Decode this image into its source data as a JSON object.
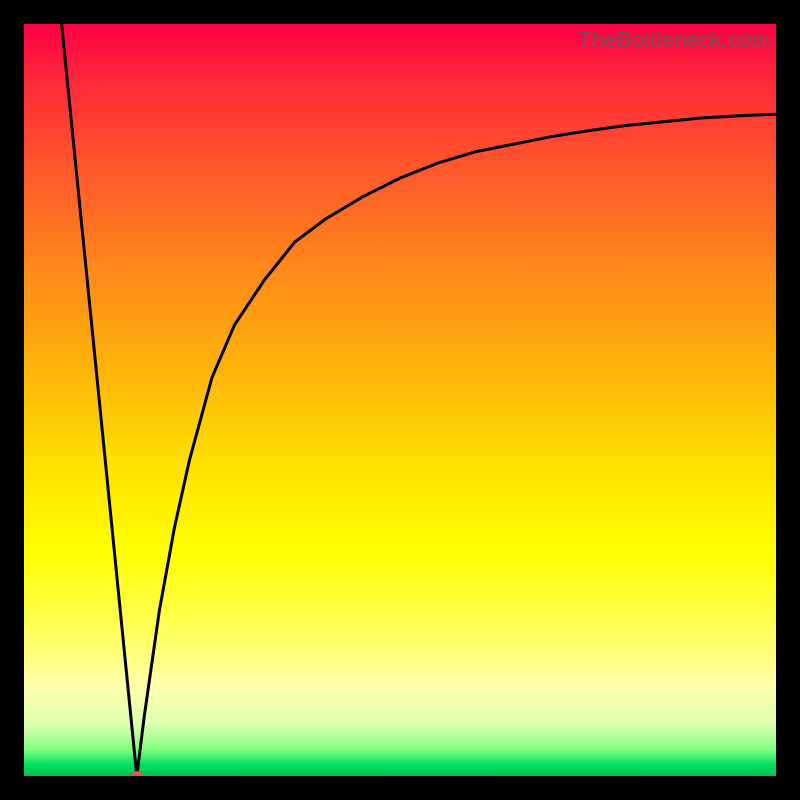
{
  "watermark": "TheBottleneck.com",
  "chart_data": {
    "type": "line",
    "title": "",
    "xlabel": "",
    "ylabel": "",
    "xlim": [
      0,
      100
    ],
    "ylim": [
      0,
      100
    ],
    "legend": false,
    "grid": false,
    "background_gradient": {
      "top_color": "#ff0044",
      "bottom_color": "#00c050",
      "description": "vertical heat gradient red-yellow-green"
    },
    "series": [
      {
        "name": "left-branch",
        "x": [
          5,
          6,
          7,
          8,
          9,
          10,
          11,
          12,
          13,
          14,
          15
        ],
        "y": [
          100,
          90,
          80,
          70,
          60,
          50,
          40,
          30,
          20,
          10,
          0
        ]
      },
      {
        "name": "right-branch",
        "x": [
          15,
          16,
          17,
          18,
          20,
          22,
          25,
          28,
          32,
          36,
          40,
          45,
          50,
          55,
          60,
          65,
          70,
          75,
          80,
          85,
          90,
          95,
          100
        ],
        "y": [
          0,
          8,
          15,
          22,
          33,
          42,
          53,
          60,
          66,
          71,
          74,
          77,
          79.5,
          81.5,
          83,
          84,
          85,
          85.8,
          86.5,
          87,
          87.5,
          87.8,
          88
        ]
      }
    ],
    "marker": {
      "x": 15,
      "y": 0,
      "color": "#d85a5a",
      "shape": "ellipse"
    }
  }
}
